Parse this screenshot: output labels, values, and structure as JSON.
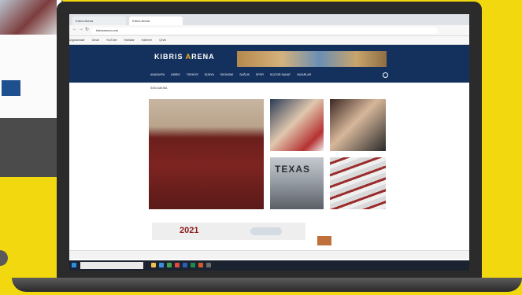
{
  "browser": {
    "tabs": [
      "Kıbrıs Arena",
      "Kıbrıs Arena"
    ],
    "url": "kibrisarena.com",
    "bookmarks": [
      "Uygulamalar",
      "Gmail",
      "YouTube",
      "Haritalar",
      "Haberler",
      "Çeviri"
    ]
  },
  "site": {
    "logo_prefix": "KIBRIS ",
    "logo_accent": "A",
    "logo_suffix": "RENA",
    "nav": [
      "ANASAYFA",
      "KIBRIS",
      "TÜRKİYE",
      "DÜNYA",
      "EKONOMİ",
      "SAĞLIK",
      "SPOR",
      "KÜLTÜR SANAT",
      "YAZARLAR"
    ],
    "nav_right": "",
    "ticker": "SON DAKİKA"
  },
  "cards": {
    "main_caption": "",
    "a_caption": "",
    "b_caption": "",
    "c_label": "TEXAS",
    "d_caption": ""
  },
  "lower": {
    "ad_year": "2021",
    "side_head": "",
    "side_text": ""
  },
  "downloads": [
    "",
    "",
    "",
    "",
    ""
  ],
  "taskbar": {
    "search_placeholder": "",
    "clock": ""
  },
  "colors": {
    "background": "#f2d90f",
    "header": "#14315e",
    "accent": "#f6b21b"
  }
}
